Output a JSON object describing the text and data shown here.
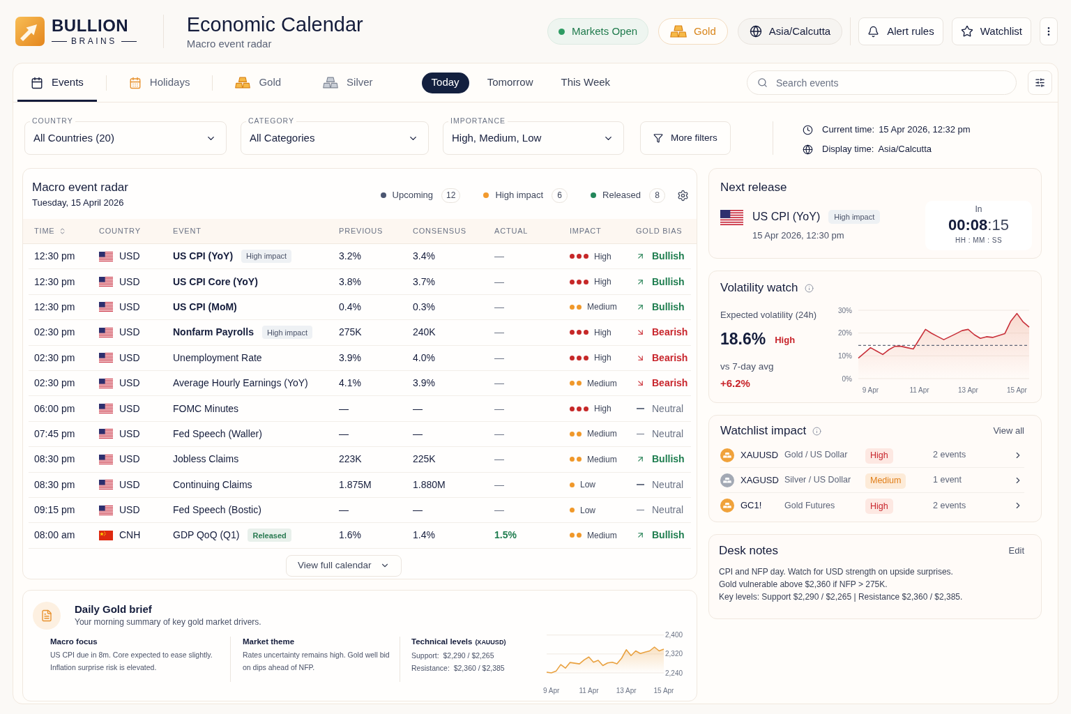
{
  "header": {
    "logo": {
      "name": "BULLION",
      "tagline": "BRAINS"
    },
    "title": "Economic Calendar",
    "subtitle": "Macro event radar",
    "pills": [
      {
        "kind": "status",
        "label": "Markets Open",
        "color": "#2e9b63"
      },
      {
        "kind": "asset",
        "label": "Gold"
      },
      {
        "kind": "timezone",
        "label": "Asia/Calcutta"
      }
    ],
    "actions": [
      {
        "kind": "alerts",
        "label": "Alert rules"
      },
      {
        "kind": "watchlist",
        "label": "Watchlist"
      },
      {
        "kind": "more"
      }
    ]
  },
  "tabs": [
    {
      "label": "Events",
      "kind": "calendar",
      "selected": true
    },
    {
      "label": "Holidays",
      "kind": "holiday",
      "selected": false
    },
    {
      "label": "Gold",
      "kind": "gold",
      "selected": false
    },
    {
      "label": "Silver",
      "kind": "silver",
      "selected": false
    }
  ],
  "periods": [
    {
      "label": "Today",
      "selected": true
    },
    {
      "label": "Tomorrow",
      "selected": false
    },
    {
      "label": "This Week",
      "selected": false
    }
  ],
  "search": {
    "placeholder": "Search events"
  },
  "filters": [
    {
      "label": "COUNTRY",
      "value": "All Countries (20)"
    },
    {
      "label": "CATEGORY",
      "value": "All Categories"
    },
    {
      "label": "IMPORTANCE",
      "value": "High, Medium, Low"
    }
  ],
  "more_filters": "More filters",
  "time_info": [
    {
      "kind": "current",
      "label": "Current time:",
      "value": "15 Apr 2026, 12:32 pm"
    },
    {
      "kind": "display",
      "label": "Display time:",
      "value": "Asia/Calcutta"
    }
  ],
  "radar": {
    "title": "Macro event radar",
    "date": "Tuesday, 15 April 2026",
    "legend": [
      {
        "label": "Upcoming",
        "count": "12",
        "color": "#4b5671"
      },
      {
        "label": "High impact",
        "count": "6",
        "color": "#f29a2e"
      },
      {
        "label": "Released",
        "count": "8",
        "color": "#23875a"
      }
    ],
    "columns": [
      {
        "label": "TIME",
        "sortable": true
      },
      {
        "label": "COUNTRY",
        "sortable": false
      },
      {
        "label": "EVENT",
        "sortable": false
      },
      {
        "label": "PREVIOUS",
        "sortable": false
      },
      {
        "label": "CONSENSUS",
        "sortable": false
      },
      {
        "label": "ACTUAL",
        "sortable": false
      },
      {
        "label": "IMPACT",
        "sortable": false
      },
      {
        "label": "GOLD BIAS",
        "sortable": false
      }
    ],
    "rows": [
      {
        "time": "12:30 pm",
        "country": {
          "kind": "us",
          "code": "USD"
        },
        "event": "US CPI (YoY)",
        "emphasized": true,
        "badge": {
          "kind": "impact",
          "label": "High impact"
        },
        "previous": "3.2%",
        "consensus": "3.4%",
        "actual": "—",
        "actual_reported": false,
        "impact": {
          "kind": "high",
          "label": "High"
        },
        "bias": {
          "kind": "bullish",
          "label": "Bullish"
        }
      },
      {
        "time": "12:30 pm",
        "country": {
          "kind": "us",
          "code": "USD"
        },
        "event": "US CPI Core (YoY)",
        "emphasized": true,
        "previous": "3.8%",
        "consensus": "3.7%",
        "actual": "—",
        "actual_reported": false,
        "impact": {
          "kind": "high",
          "label": "High"
        },
        "bias": {
          "kind": "bullish",
          "label": "Bullish"
        }
      },
      {
        "time": "12:30 pm",
        "country": {
          "kind": "us",
          "code": "USD"
        },
        "event": "US CPI (MoM)",
        "emphasized": true,
        "previous": "0.4%",
        "consensus": "0.3%",
        "actual": "—",
        "actual_reported": false,
        "impact": {
          "kind": "medium",
          "label": "Medium"
        },
        "bias": {
          "kind": "bullish",
          "label": "Bullish"
        }
      },
      {
        "time": "02:30 pm",
        "country": {
          "kind": "us",
          "code": "USD"
        },
        "event": "Nonfarm Payrolls",
        "emphasized": true,
        "badge": {
          "kind": "impact",
          "label": "High impact"
        },
        "previous": "275K",
        "consensus": "240K",
        "actual": "—",
        "actual_reported": false,
        "impact": {
          "kind": "high",
          "label": "High"
        },
        "bias": {
          "kind": "bearish",
          "label": "Bearish"
        }
      },
      {
        "time": "02:30 pm",
        "country": {
          "kind": "us",
          "code": "USD"
        },
        "event": "Unemployment Rate",
        "emphasized": false,
        "previous": "3.9%",
        "consensus": "4.0%",
        "actual": "—",
        "actual_reported": false,
        "impact": {
          "kind": "high",
          "label": "High"
        },
        "bias": {
          "kind": "bearish",
          "label": "Bearish"
        }
      },
      {
        "time": "02:30 pm",
        "country": {
          "kind": "us",
          "code": "USD"
        },
        "event": "Average Hourly Earnings (YoY)",
        "emphasized": false,
        "previous": "4.1%",
        "consensus": "3.9%",
        "actual": "—",
        "actual_reported": false,
        "impact": {
          "kind": "medium",
          "label": "Medium"
        },
        "bias": {
          "kind": "bearish",
          "label": "Bearish"
        }
      },
      {
        "time": "06:00 pm",
        "country": {
          "kind": "us",
          "code": "USD"
        },
        "event": "FOMC Minutes",
        "emphasized": false,
        "previous": "—",
        "consensus": "—",
        "actual": "—",
        "actual_reported": false,
        "impact": {
          "kind": "high",
          "label": "High"
        },
        "bias": {
          "kind": "neutral",
          "label": "Neutral"
        }
      },
      {
        "time": "07:45 pm",
        "country": {
          "kind": "us",
          "code": "USD"
        },
        "event": "Fed Speech (Waller)",
        "emphasized": false,
        "previous": "—",
        "consensus": "—",
        "actual": "—",
        "actual_reported": false,
        "impact": {
          "kind": "medium",
          "label": "Medium"
        },
        "bias": {
          "kind": "neutral",
          "label": "Neutral"
        }
      },
      {
        "time": "08:30 pm",
        "country": {
          "kind": "us",
          "code": "USD"
        },
        "event": "Jobless Claims",
        "emphasized": false,
        "previous": "223K",
        "consensus": "225K",
        "actual": "—",
        "actual_reported": false,
        "impact": {
          "kind": "medium",
          "label": "Medium"
        },
        "bias": {
          "kind": "bullish",
          "label": "Bullish"
        }
      },
      {
        "time": "08:30 pm",
        "country": {
          "kind": "us",
          "code": "USD"
        },
        "event": "Continuing Claims",
        "emphasized": false,
        "previous": "1.875M",
        "consensus": "1.880M",
        "actual": "—",
        "actual_reported": false,
        "impact": {
          "kind": "low",
          "label": "Low"
        },
        "bias": {
          "kind": "neutral",
          "label": "Neutral"
        }
      },
      {
        "time": "09:15 pm",
        "country": {
          "kind": "us",
          "code": "USD"
        },
        "event": "Fed Speech (Bostic)",
        "emphasized": false,
        "previous": "—",
        "consensus": "—",
        "actual": "—",
        "actual_reported": false,
        "impact": {
          "kind": "low",
          "label": "Low"
        },
        "bias": {
          "kind": "neutral",
          "label": "Neutral"
        }
      },
      {
        "time": "08:00 am",
        "country": {
          "kind": "cn",
          "code": "CNH"
        },
        "event": "GDP QoQ (Q1)",
        "emphasized": false,
        "badge": {
          "kind": "released",
          "label": "Released"
        },
        "previous": "1.6%",
        "consensus": "1.4%",
        "actual": "1.5%",
        "actual_reported": true,
        "impact": {
          "kind": "medium",
          "label": "Medium"
        },
        "bias": {
          "kind": "bullish",
          "label": "Bullish"
        }
      }
    ],
    "footer_button": "View full calendar"
  },
  "next_release": {
    "title": "Next release",
    "country": {
      "kind": "us"
    },
    "event": "US CPI (YoY)",
    "badge": "High impact",
    "datetime": "15 Apr 2026, 12:30 pm",
    "countdown": {
      "prefix": "In",
      "main": "00:08",
      "seconds": ":15",
      "units": "HH : MM : SS"
    }
  },
  "volatility": {
    "title": "Volatility watch",
    "metric_label": "Expected volatility (24h)",
    "value": "18.6%",
    "level_label": "High",
    "comparison_label": "vs 7-day avg",
    "comparison_value": "+6.2%",
    "chart_data": {
      "type": "area",
      "categories": [
        null,
        null,
        "9 Apr",
        null,
        null,
        null,
        null,
        null,
        null,
        null,
        "11 Apr",
        null,
        null,
        null,
        null,
        null,
        null,
        null,
        "13 Apr",
        null,
        null,
        null,
        null,
        null,
        null,
        null,
        "15 Apr",
        null,
        null
      ],
      "series": [
        {
          "color": "#c8303a",
          "values": [
            9,
            11.3,
            13.6,
            12.1,
            10.6,
            12.7,
            14.2,
            14.2,
            13.6,
            13.0,
            17.3,
            21.6,
            19.9,
            18.5,
            17.1,
            18.4,
            19.7,
            21.1,
            21.6,
            19.3,
            17.7,
            18.4,
            18.1,
            18.9,
            19.7,
            25.3,
            28.6,
            24.9,
            22.6
          ]
        }
      ],
      "ylim": [
        0,
        30
      ],
      "yticks": [
        {
          "value": 0,
          "label": "0%"
        },
        {
          "value": 10,
          "label": "10%"
        },
        {
          "value": 20,
          "label": "20%"
        },
        {
          "value": 30,
          "label": "30%"
        }
      ],
      "ref_lines": [
        {
          "axis": "y",
          "value": 14.6
        }
      ]
    }
  },
  "watchlist": {
    "title": "Watchlist impact",
    "link": "View all",
    "items": [
      {
        "kind": "gold",
        "symbol": "XAUUSD",
        "name": "Gold / US Dollar",
        "impact": {
          "kind": "high",
          "label": "High"
        },
        "events": "2 events"
      },
      {
        "kind": "silver",
        "symbol": "XAGUSD",
        "name": "Silver / US Dollar",
        "impact": {
          "kind": "medium",
          "label": "Medium"
        },
        "events": "1 event"
      },
      {
        "kind": "gold",
        "symbol": "GC1!",
        "name": "Gold Futures",
        "impact": {
          "kind": "high",
          "label": "High"
        },
        "events": "2 events"
      }
    ]
  },
  "desk_notes": {
    "title": "Desk notes",
    "action": "Edit",
    "lines": [
      "CPI and NFP day. Watch for USD strength on upside surprises.",
      "Gold vulnerable above $2,360 if NFP > 275K.",
      "Key levels: Support $2,290 / $2,265 | Resistance $2,360 / $2,385."
    ]
  },
  "daily_brief": {
    "title": "Daily Gold brief",
    "subtitle": "Your morning summary of key gold market drivers.",
    "sections": [
      {
        "kind": "text",
        "title": "Macro focus",
        "text": "US CPI due in 8m. Core expected to ease slightly. Inflation surprise risk is elevated."
      },
      {
        "kind": "text",
        "title": "Market theme",
        "text": "Rates uncertainty remains high. Gold well bid on dips ahead of NFP."
      },
      {
        "kind": "levels",
        "title": "Technical levels",
        "note": "(XAUUSD)",
        "lines": [
          "Support:  $2,290 / $2,265",
          "Resistance:  $2,360 / $2,385"
        ]
      }
    ],
    "chart_data": {
      "type": "area",
      "categories": [
        null,
        "9 Apr",
        null,
        null,
        null,
        null,
        null,
        null,
        null,
        "11 Apr",
        null,
        null,
        null,
        null,
        null,
        null,
        null,
        "13 Apr",
        null,
        null,
        null,
        null,
        null,
        null,
        null,
        "15 Apr"
      ],
      "series": [
        {
          "color": "#e9a13f",
          "values": [
            2243,
            2240,
            2247,
            2275,
            2260,
            2284,
            2281,
            2278,
            2295,
            2307,
            2285,
            2293,
            2271,
            2282,
            2285,
            2278,
            2302,
            2338,
            2313,
            2333,
            2322,
            2328,
            2333,
            2349,
            2333,
            2340
          ]
        }
      ],
      "ylim": [
        2240,
        2400
      ],
      "yticks": [
        {
          "value": 2240,
          "label": "2,240"
        },
        {
          "value": 2320,
          "label": "2,320"
        },
        {
          "value": 2400,
          "label": "2,400"
        }
      ]
    }
  }
}
